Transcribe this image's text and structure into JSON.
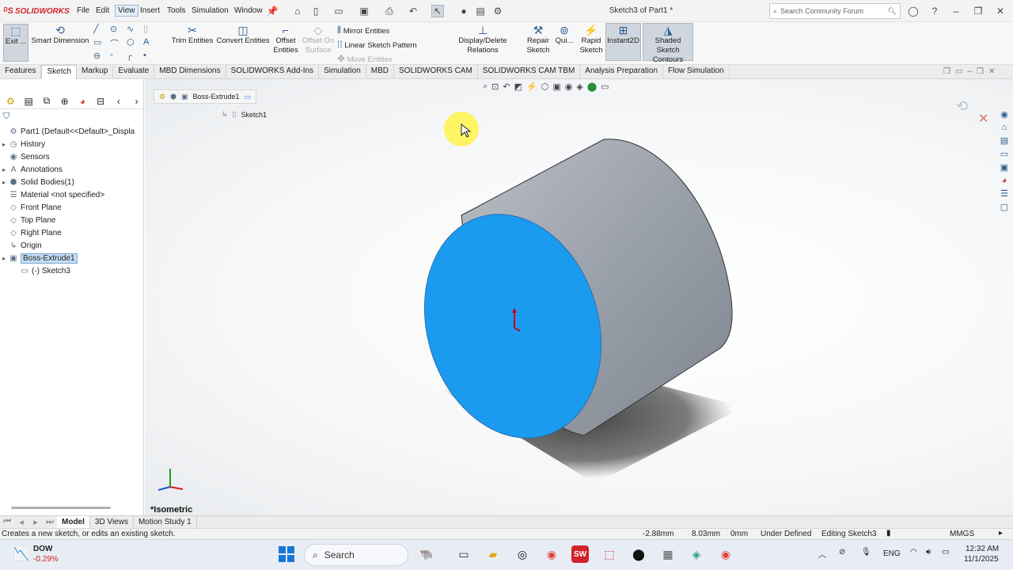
{
  "app": {
    "brand": "SOLIDWORKS",
    "doc_title": "Sketch3 of Part1 *",
    "brand_color": "#d2232a"
  },
  "menu": {
    "file": "File",
    "edit": "Edit",
    "view": "View",
    "insert": "Insert",
    "tools": "Tools",
    "simulation": "Simulation",
    "window": "Window"
  },
  "search": {
    "placeholder": "Search Community Forum"
  },
  "ribbon": {
    "exit": "Exit ...",
    "smart_dimension": "Smart Dimension",
    "trim": "Trim Entities",
    "convert": "Convert Entities",
    "offset": "Offset Entities",
    "offset_surface": "Offset On Surface",
    "mirror": "Mirror Entities",
    "linear_pattern": "Linear Sketch Pattern",
    "move": "Move Entities",
    "display_delete": "Display/Delete Relations",
    "repair": "Repair Sketch",
    "quick": "Qui...",
    "rapid": "Rapid Sketch",
    "instant2d": "Instant2D",
    "shaded": "Shaded Sketch Contours"
  },
  "tabs": [
    "Features",
    "Sketch",
    "Markup",
    "Evaluate",
    "MBD Dimensions",
    "SOLIDWORKS Add-Ins",
    "Simulation",
    "MBD",
    "SOLIDWORKS CAM",
    "SOLIDWORKS CAM TBM",
    "Analysis Preparation",
    "Flow Simulation"
  ],
  "active_tab": "Sketch",
  "tree": [
    {
      "label": "Part1  (Default<<Default>_Displa",
      "icon": "part-icon",
      "arrow": ""
    },
    {
      "label": "History",
      "icon": "history-icon",
      "arrow": "▸"
    },
    {
      "label": "Sensors",
      "icon": "sensors-icon",
      "arrow": ""
    },
    {
      "label": "Annotations",
      "icon": "annotations-icon",
      "arrow": "▸"
    },
    {
      "label": "Solid Bodies(1)",
      "icon": "solid-bodies-icon",
      "arrow": "▸"
    },
    {
      "label": "Material <not specified>",
      "icon": "material-icon",
      "arrow": ""
    },
    {
      "label": "Front Plane",
      "icon": "plane-icon",
      "arrow": ""
    },
    {
      "label": "Top Plane",
      "icon": "plane-icon",
      "arrow": ""
    },
    {
      "label": "Right Plane",
      "icon": "plane-icon",
      "arrow": ""
    },
    {
      "label": "Origin",
      "icon": "origin-icon",
      "arrow": ""
    },
    {
      "label": "Boss-Extrude1",
      "icon": "extrude-icon",
      "arrow": "▸"
    },
    {
      "label": "(-) Sketch3",
      "icon": "sketch-icon",
      "arrow": ""
    }
  ],
  "selected_tree_item": "Boss-Extrude1",
  "breadcrumb": {
    "item1": "Boss-Extrude1",
    "item2": "Sketch1"
  },
  "viewport": {
    "view_name": "*Isometric",
    "face_color": "#1a9bf0",
    "body_color": "#9aa0aa"
  },
  "bottom_tabs": [
    "Model",
    "3D Views",
    "Motion Study 1"
  ],
  "status": {
    "message": "Creates a new sketch, or edits an existing sketch.",
    "x": "-2.88mm",
    "y": "8.03mm",
    "z": "0mm",
    "state": "Under Defined",
    "mode": "Editing Sketch3",
    "units": "MMGS"
  },
  "taskbar": {
    "stock_name": "DOW",
    "stock_change": "-0.29%",
    "search": "Search",
    "lang": "ENG",
    "time": "12:32 AM",
    "date": "11/1/2025"
  }
}
